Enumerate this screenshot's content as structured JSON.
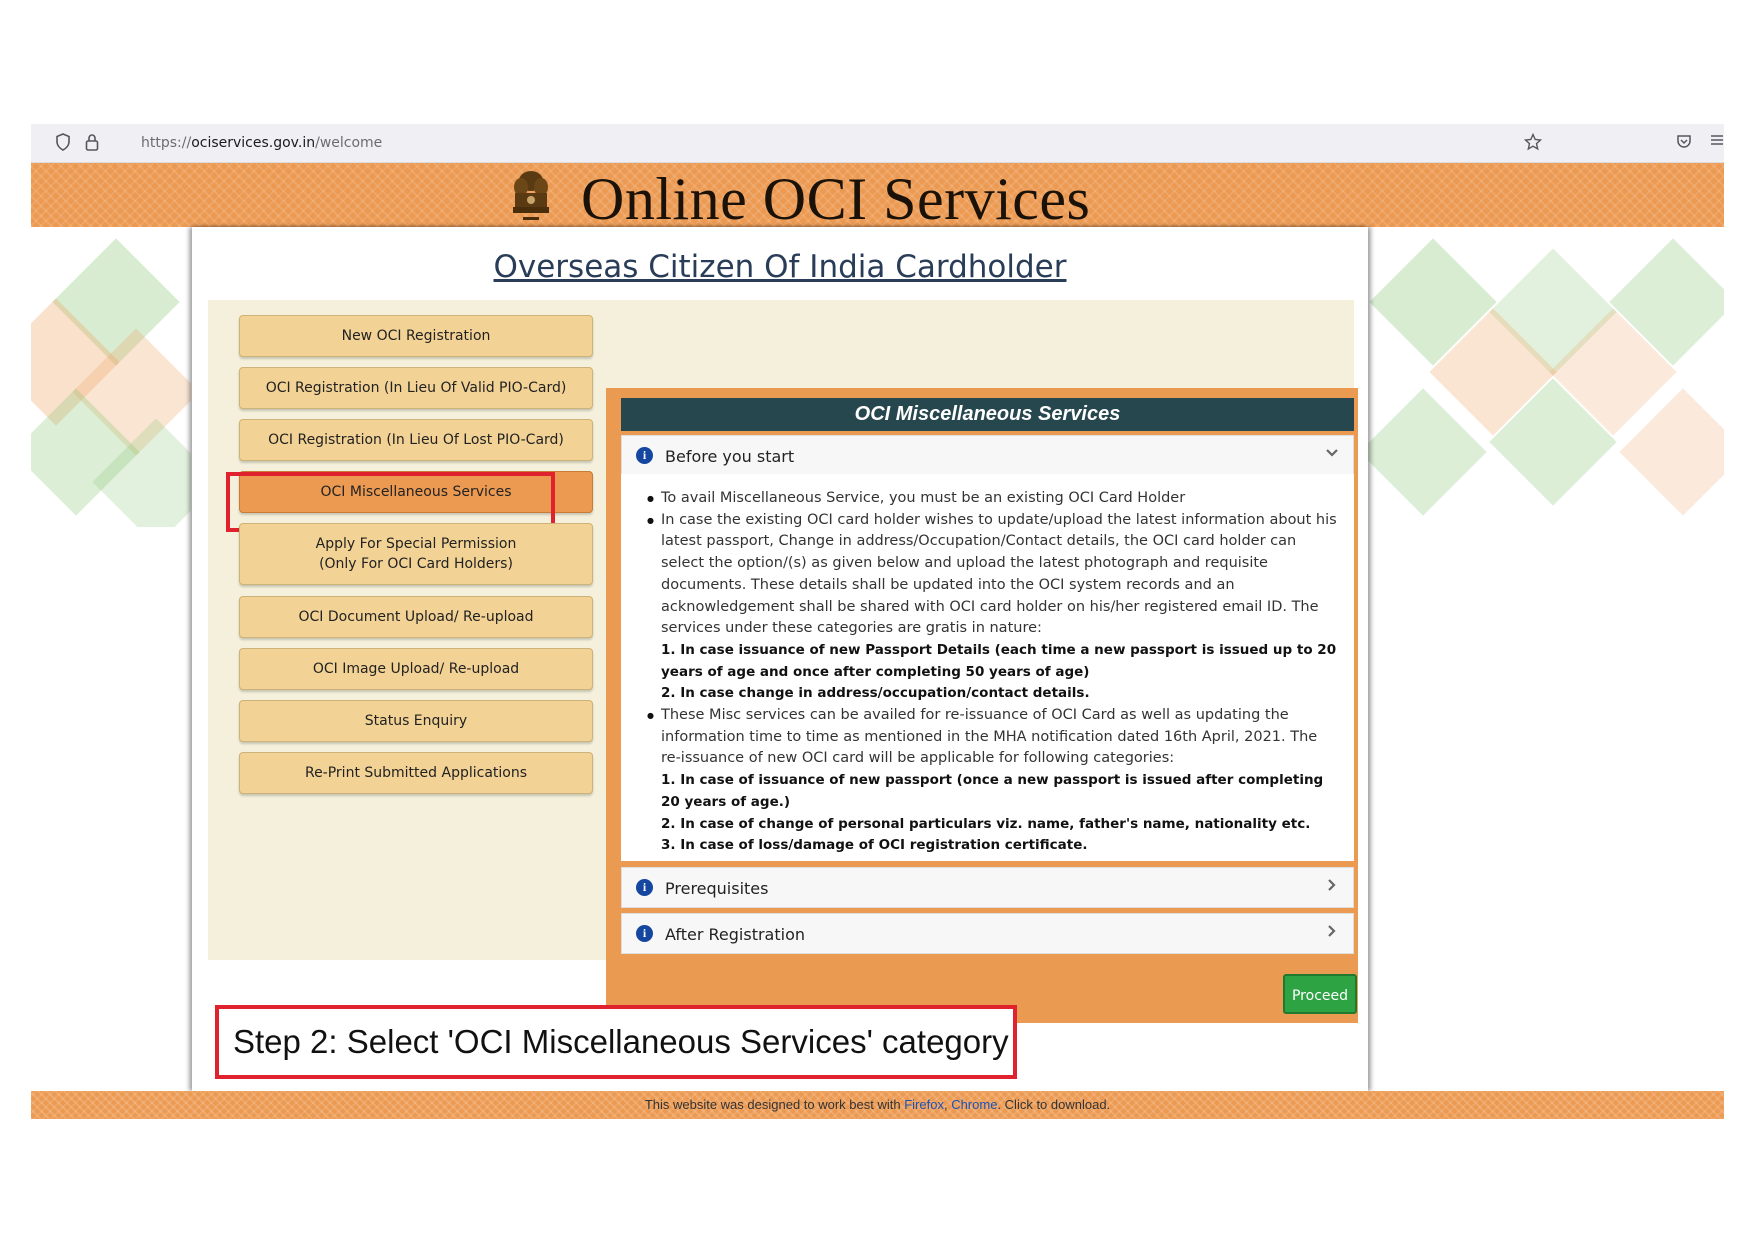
{
  "browser": {
    "url_scheme": "https://",
    "url_host": "ociservices.gov.in",
    "url_path": "/welcome"
  },
  "header": {
    "title": "Online OCI Services"
  },
  "page": {
    "subtitle": "Overseas Citizen Of India Cardholder"
  },
  "menu": {
    "items": [
      {
        "label": "New OCI Registration"
      },
      {
        "label": "OCI Registration (In Lieu Of Valid PIO-Card)"
      },
      {
        "label": "OCI Registration (In Lieu Of Lost PIO-Card)"
      },
      {
        "label": "OCI Miscellaneous Services"
      },
      {
        "label_line1": "Apply For Special Permission",
        "label_line2": "(Only For OCI Card Holders)"
      },
      {
        "label": "OCI Document Upload/ Re-upload"
      },
      {
        "label": "OCI Image Upload/ Re-upload"
      },
      {
        "label": "Status Enquiry"
      },
      {
        "label": "Re-Print Submitted Applications"
      }
    ],
    "active_index": 3
  },
  "card": {
    "title": "OCI Miscellaneous Services",
    "before_start": {
      "label": "Before you start",
      "bullet1": "To avail Miscellaneous Service, you must be an existing OCI Card Holder",
      "bullet2": "In case the existing OCI card holder wishes to update/upload the latest information about his latest passport, Change in address/Occupation/Contact details, the OCI card holder can select the option/(s) as given below and upload the latest photograph and requisite documents. These details shall be updated into the OCI system records and an acknowledgement shall be shared with OCI card holder on his/her registered email ID. The services under these categories are gratis in nature:",
      "bullet2_item1": "1. In case issuance of new Passport Details (each time a new passport is issued up to 20 years of age and once after completing 50 years of age)",
      "bullet2_item2": "2. In case change in address/occupation/contact details.",
      "bullet3": "These Misc services can be availed for re-issuance of OCI Card as well as updating the information time to time as mentioned in the MHA notification dated 16th April, 2021. The re-issuance of new OCI card will be applicable for following categories:",
      "bullet3_item1": "1. In case of issuance of new passport (once a new passport is issued after completing 20 years of age.)",
      "bullet3_item2": "2. In case of change of personal particulars viz. name, father's name, nationality etc.",
      "bullet3_item3": "3. In case of loss/damage of OCI registration certificate."
    },
    "prerequisites_label": "Prerequisites",
    "after_registration_label": "After Registration",
    "proceed_label": "Proceed"
  },
  "annotation": {
    "step_text": "Step 2: Select 'OCI Miscellaneous Services' category"
  },
  "footer": {
    "text_before": "This website was designed to work best with ",
    "firefox": "Firefox",
    "sep": ", ",
    "chrome": "Chrome",
    "text_after": ". Click to download."
  },
  "icons": {
    "shield": "shield-icon",
    "lock": "lock-icon",
    "star": "bookmark-star-icon",
    "pocket": "pocket-icon",
    "menu": "hamburger-menu-icon",
    "info": "info-icon",
    "chevron_down": "chevron-down-icon",
    "chevron_right": "chevron-right-icon"
  },
  "colors": {
    "header_orange": "#ec9a52",
    "menu_button": "#f3d395",
    "card_title_bg": "#27474f",
    "proceed_green": "#2ea343",
    "highlight_red": "#e0222e"
  }
}
